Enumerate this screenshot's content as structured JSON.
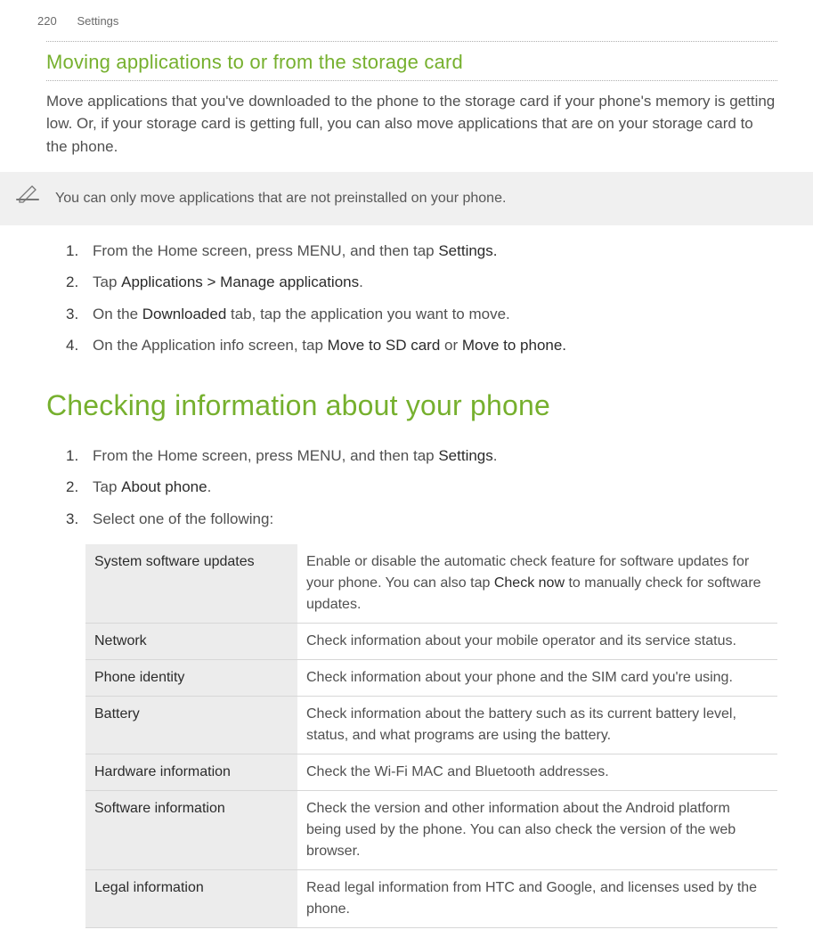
{
  "header": {
    "page_number": "220",
    "chapter": "Settings"
  },
  "section1": {
    "title": "Moving applications to or from the storage card",
    "intro": "Move applications that you've downloaded to the phone to the storage card if your phone's memory is getting low. Or, if your storage card is getting full, you can also move applications that are on your storage card to the phone.",
    "note": "You can only move applications that are not preinstalled on your phone.",
    "steps": [
      {
        "pre": "From the Home screen, press MENU, and then tap ",
        "bold": "Settings.",
        "post": ""
      },
      {
        "pre": "Tap ",
        "bold": "Applications > Manage applications",
        "post": "."
      },
      {
        "pre": "On the ",
        "bold": "Downloaded",
        "post": " tab, tap the application you want to move."
      },
      {
        "pre": "On the Application info screen, tap ",
        "bold": "Move to SD card",
        "post_mid": " or ",
        "bold2": "Move to phone.",
        "post": ""
      }
    ]
  },
  "section2": {
    "title": "Checking information about your phone",
    "steps": [
      {
        "pre": "From the Home screen, press MENU, and then tap ",
        "bold": "Settings",
        "post": "."
      },
      {
        "pre": "Tap ",
        "bold": "About phone",
        "post": "."
      },
      {
        "pre": "Select one of the following:",
        "bold": "",
        "post": ""
      }
    ],
    "table": [
      {
        "label": "System software updates",
        "desc_pre": "Enable or disable the automatic check feature for software updates for your phone. You can also tap ",
        "desc_bold": "Check now",
        "desc_post": " to manually check for software updates."
      },
      {
        "label": "Network",
        "desc_pre": "Check information about your mobile operator and its service status.",
        "desc_bold": "",
        "desc_post": ""
      },
      {
        "label": "Phone identity",
        "desc_pre": "Check information about your phone and the SIM card you're using.",
        "desc_bold": "",
        "desc_post": ""
      },
      {
        "label": "Battery",
        "desc_pre": "Check information about the battery such as its current battery level, status, and what programs are using the battery.",
        "desc_bold": "",
        "desc_post": ""
      },
      {
        "label": "Hardware information",
        "desc_pre": "Check the Wi-Fi MAC and Bluetooth addresses.",
        "desc_bold": "",
        "desc_post": ""
      },
      {
        "label": "Software information",
        "desc_pre": "Check the version and other information about the Android platform being used by the phone. You can also check the version of the web browser.",
        "desc_bold": "",
        "desc_post": ""
      },
      {
        "label": "Legal information",
        "desc_pre": "Read legal information from HTC and Google, and licenses used by the phone.",
        "desc_bold": "",
        "desc_post": ""
      }
    ]
  }
}
